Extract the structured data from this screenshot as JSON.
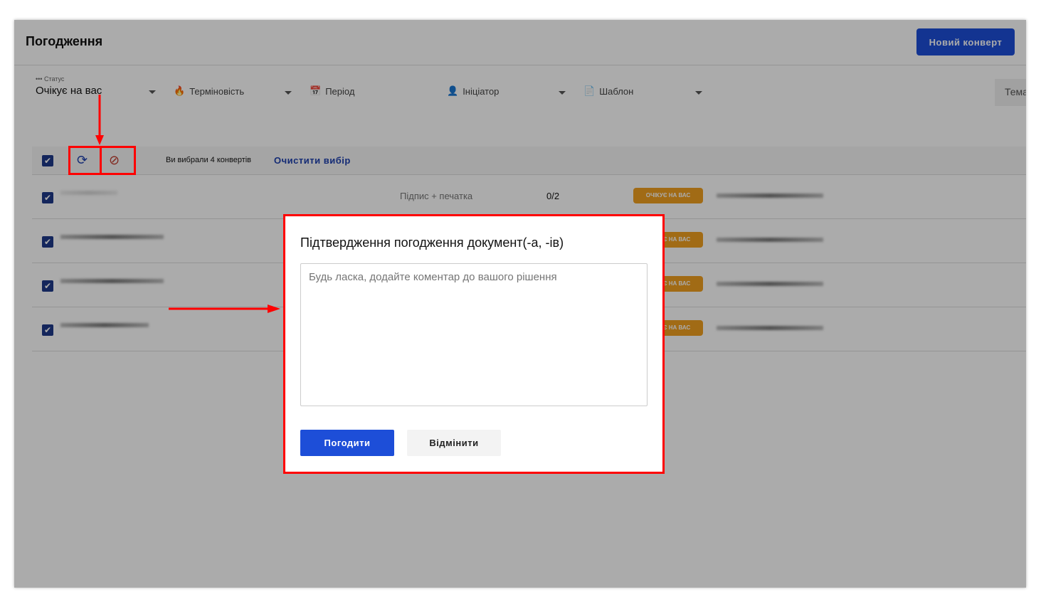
{
  "header": {
    "title": "Погодження",
    "new_envelope": "Новий конверт"
  },
  "filters": {
    "status_label": "Статус",
    "status_value": "Очікує на вас",
    "urgency": "Терміновість",
    "period": "Період",
    "initiator": "Ініціатор",
    "template": "Шаблон",
    "topic": "Тема"
  },
  "selection": {
    "text": "Ви вибрали 4 конвертів",
    "clear": "Очистити вибір"
  },
  "rows": [
    {
      "type": "Підпис + печатка",
      "count": "0/2",
      "status": "ОЧІКУЄ НА ВАС"
    },
    {
      "status": "ОЧІКУЄ НА ВАС"
    },
    {
      "status": "ОЧІКУЄ НА ВАС"
    },
    {
      "status": "ОЧІКУЄ НА ВАС"
    }
  ],
  "modal": {
    "title": "Підтвердження погодження документ(-а, -ів)",
    "placeholder": "Будь ласка, додайте коментар до вашого рішення",
    "confirm": "Погодити",
    "cancel": "Відмінити"
  },
  "colors": {
    "accent": "#1d4ed8",
    "badge": "#f0a020",
    "annotation": "#ff0000"
  }
}
